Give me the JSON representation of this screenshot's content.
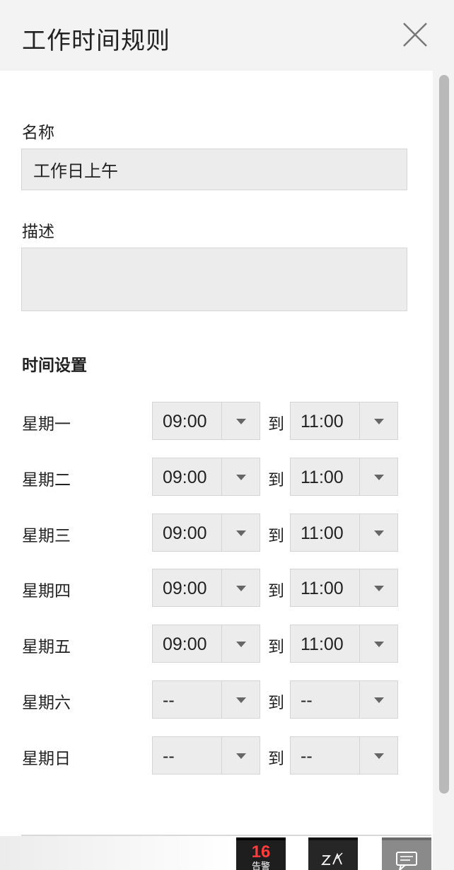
{
  "header": {
    "title": "工作时间规则"
  },
  "form": {
    "name_label": "名称",
    "name_value": "工作日上午",
    "description_label": "描述",
    "description_value": ""
  },
  "time_settings": {
    "title": "时间设置",
    "to_label": "到",
    "days": [
      {
        "label": "星期一",
        "start": "09:00",
        "end": "11:00"
      },
      {
        "label": "星期二",
        "start": "09:00",
        "end": "11:00"
      },
      {
        "label": "星期三",
        "start": "09:00",
        "end": "11:00"
      },
      {
        "label": "星期四",
        "start": "09:00",
        "end": "11:00"
      },
      {
        "label": "星期五",
        "start": "09:00",
        "end": "11:00"
      },
      {
        "label": "星期六",
        "start": "--",
        "end": "--"
      },
      {
        "label": "星期日",
        "start": "--",
        "end": "--"
      }
    ]
  },
  "floating": {
    "alarm_count": "16",
    "alarm_label": "告警"
  },
  "colors": {
    "header_bg": "#f3f3f3",
    "input_bg": "#ececec",
    "alarm_count": "#ff3b3b"
  }
}
